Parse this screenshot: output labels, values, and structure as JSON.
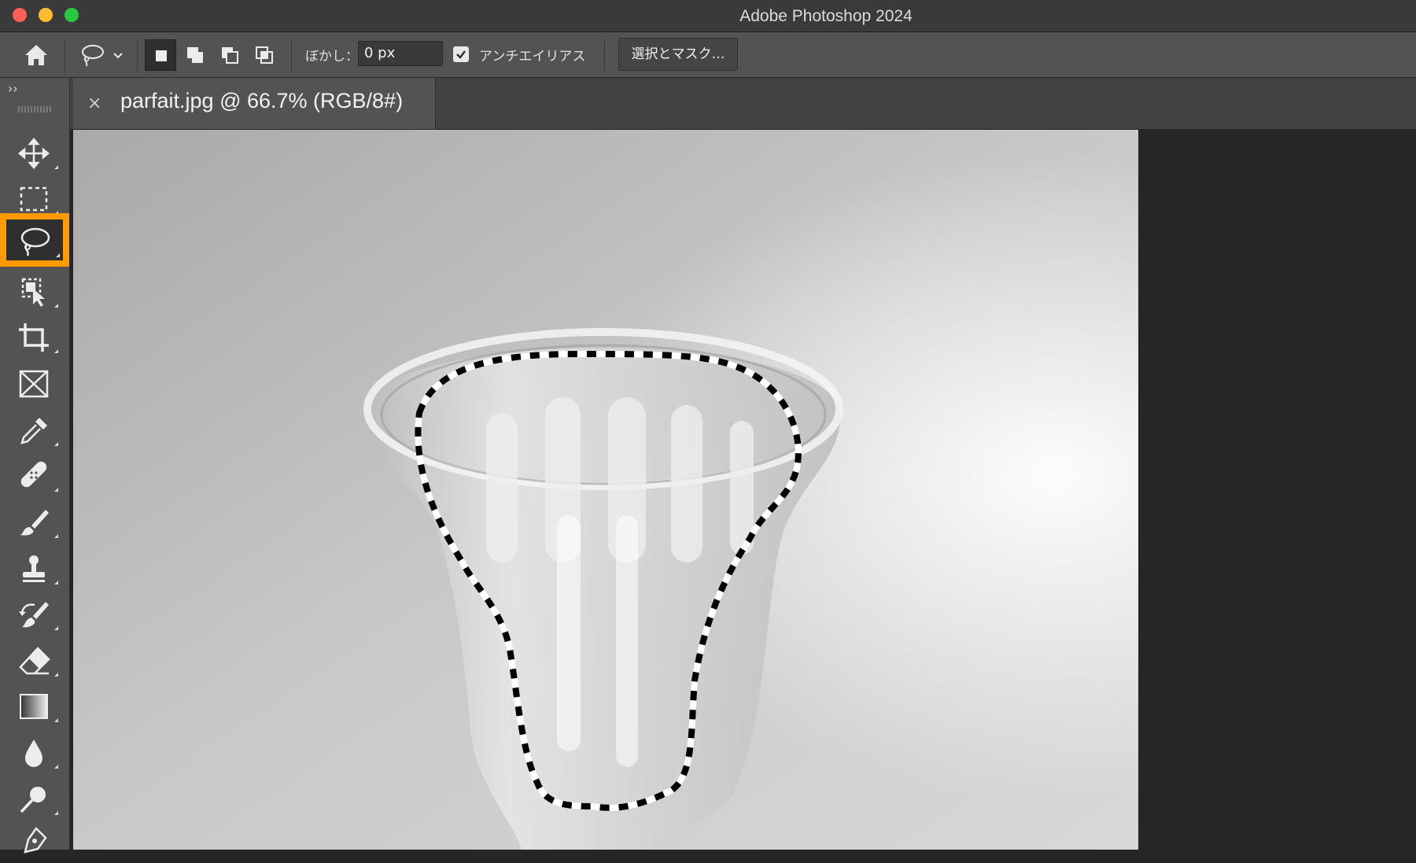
{
  "window": {
    "title": "Adobe Photoshop 2024"
  },
  "options_bar": {
    "feather_label": "ぼかし：",
    "feather_value": "0 px",
    "antialias_label": "アンチエイリアス",
    "antialias_checked": true,
    "select_and_mask_label": "選択とマスク…"
  },
  "document_tab": {
    "title": "parfait.jpg @ 66.7% (RGB/8#)",
    "close_glyph": "×"
  },
  "toolbox": {
    "collapse_glyph": "››",
    "active_tool": "lasso-tool",
    "highlight_color": "#ff9a00",
    "tools": [
      "move-tool",
      "rectangular-marquee-tool",
      "lasso-tool",
      "object-selection-tool",
      "crop-tool",
      "frame-tool",
      "eyedropper-tool",
      "spot-healing-brush-tool",
      "brush-tool",
      "clone-stamp-tool",
      "history-brush-tool",
      "eraser-tool",
      "gradient-tool",
      "blur-tool",
      "dodge-tool",
      "pen-tool"
    ]
  },
  "canvas": {
    "subject": "glass parfait cup",
    "selection_style": "marching-ants"
  }
}
